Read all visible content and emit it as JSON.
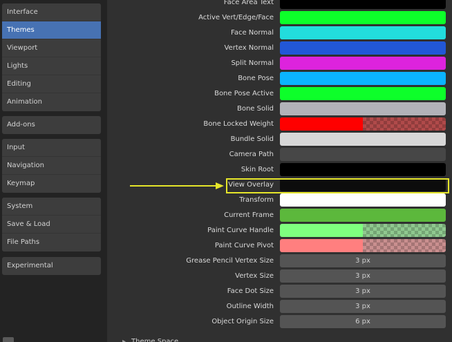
{
  "sidebar": {
    "groups": [
      [
        "Interface",
        "Themes",
        "Viewport",
        "Lights",
        "Editing",
        "Animation"
      ],
      [
        "Add-ons"
      ],
      [
        "Input",
        "Navigation",
        "Keymap"
      ],
      [
        "System",
        "Save & Load",
        "File Paths"
      ],
      [
        "Experimental"
      ]
    ],
    "active": "Themes"
  },
  "rows": [
    {
      "label": "Face Area Text",
      "kind": "color",
      "color": "#000000"
    },
    {
      "label": "Active Vert/Edge/Face",
      "kind": "color",
      "color": "#0dff2a"
    },
    {
      "label": "Face Normal",
      "kind": "color",
      "color": "#22dddd"
    },
    {
      "label": "Vertex Normal",
      "kind": "color",
      "color": "#2257d7"
    },
    {
      "label": "Split Normal",
      "kind": "color",
      "color": "#dd23dd"
    },
    {
      "label": "Bone Pose",
      "kind": "color",
      "color": "#0bb4ff"
    },
    {
      "label": "Bone Pose Active",
      "kind": "color",
      "color": "#0dff2a"
    },
    {
      "label": "Bone Solid",
      "kind": "color",
      "color": "#b2b2b8"
    },
    {
      "label": "Bone Locked Weight",
      "kind": "color-alpha",
      "color": "#ff0000",
      "checker": "#b04a4a",
      "alpha": 0.5
    },
    {
      "label": "Bundle Solid",
      "kind": "color",
      "color": "#d8d8d8"
    },
    {
      "label": "Camera Path",
      "kind": "color",
      "color": "#474747"
    },
    {
      "label": "Skin Root",
      "kind": "color",
      "color": "#000000"
    },
    {
      "label": "View Overlay",
      "kind": "color",
      "color": "#0c0c0c"
    },
    {
      "label": "Transform",
      "kind": "color",
      "color": "#ffffff"
    },
    {
      "label": "Current Frame",
      "kind": "color",
      "color": "#5cb83c"
    },
    {
      "label": "Paint Curve Handle",
      "kind": "color-alpha",
      "color": "#7fff7f",
      "checker": "#8fc98f",
      "alpha": 0.5
    },
    {
      "label": "Paint Curve Pivot",
      "kind": "color-alpha",
      "color": "#ff7f7f",
      "checker": "#c98f8f",
      "alpha": 0.5
    },
    {
      "label": "Grease Pencil Vertex Size",
      "kind": "number",
      "value": "3 px"
    },
    {
      "label": "Vertex Size",
      "kind": "number",
      "value": "3 px"
    },
    {
      "label": "Face Dot Size",
      "kind": "number",
      "value": "3 px"
    },
    {
      "label": "Outline Width",
      "kind": "number",
      "value": "3 px"
    },
    {
      "label": "Object Origin Size",
      "kind": "number",
      "value": "6 px"
    }
  ],
  "highlighted_row": "View Overlay",
  "annotation": {
    "arrow_color": "#e6e62a",
    "highlight_color": "#e6e62a"
  },
  "section_collapsed": "Theme Space"
}
